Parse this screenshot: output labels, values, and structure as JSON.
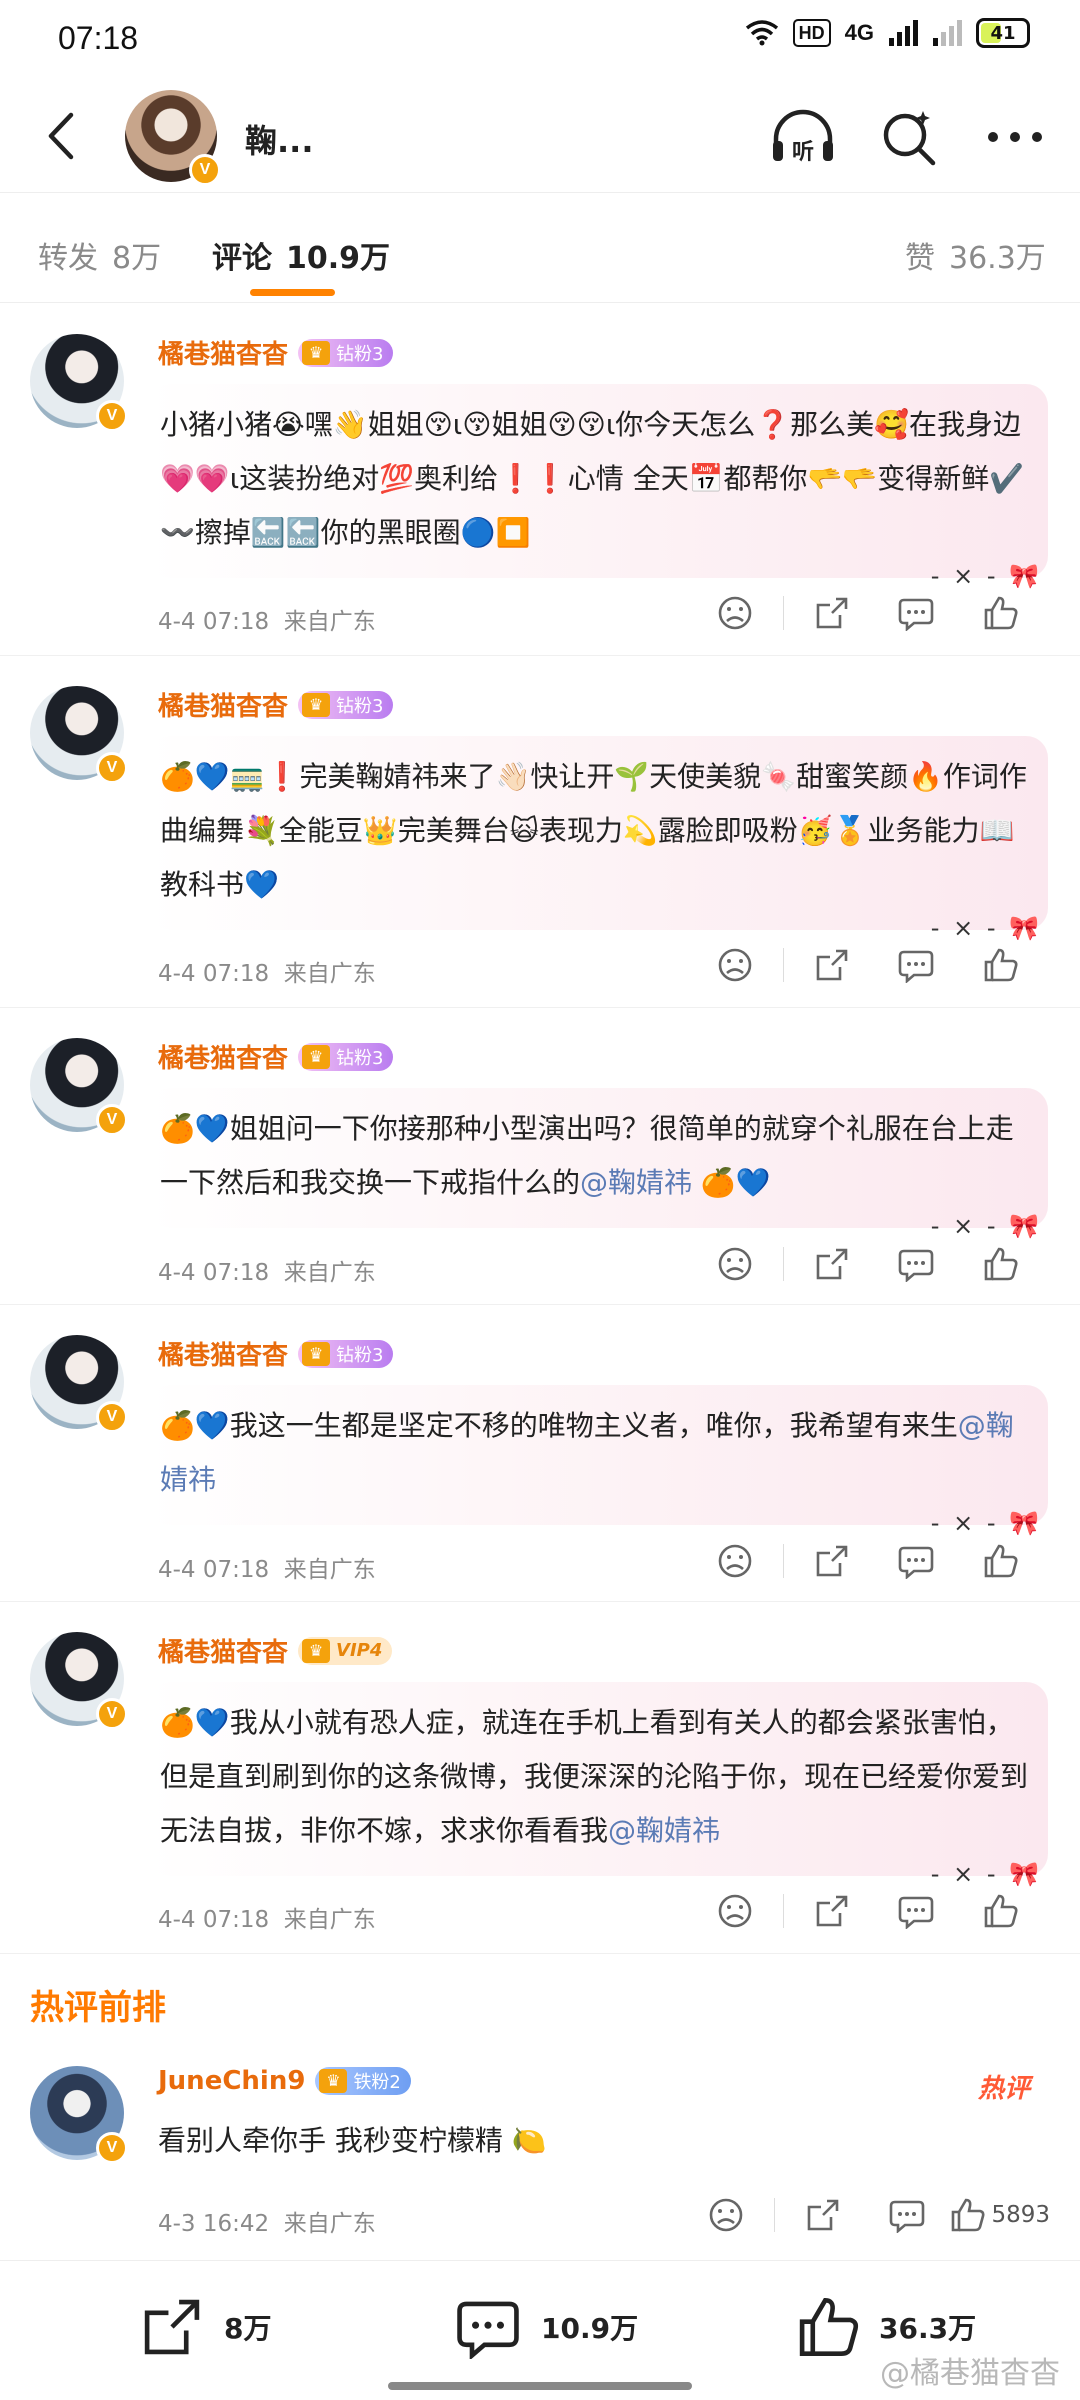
{
  "status_bar": {
    "time": "07:18",
    "network": "4G",
    "hd": "HD",
    "battery": "41"
  },
  "header": {
    "title": "鞠..."
  },
  "tabs": [
    {
      "label": "转发",
      "count": "8万"
    },
    {
      "label": "评论",
      "count": "10.9万"
    },
    {
      "label": "赞",
      "count": "36.3万"
    }
  ],
  "comments": [
    {
      "user": "橘巷猫杳杳",
      "badge": "钻粉3",
      "text_parts": [
        "小猪小猪😭嘿👋姐姐😚ι😚姐姐😚😚ι你今天怎么❓那么美🥰在我身边💗💗ι这装扮绝对💯奥利给❗❗心情 全天📅都帮你🫳🫳变得新鲜✔️〰️擦掉🔙🔙你的黑眼圈🔵⏹️"
      ],
      "mention": "",
      "text_after": "",
      "date": "4-4 07:18",
      "location": "来自广东"
    },
    {
      "user": "橘巷猫杳杳",
      "badge": "钻粉3",
      "text_parts": [
        "🍊💙🚃❗完美鞠婧祎来了👋🏻快让开🌱天使美貌🍬甜蜜笑颜🔥作词作曲编舞💐全能豆👑完美舞台🙀表现力💫露脸即吸粉🥳🏅业务能力📖教科书💙"
      ],
      "mention": "",
      "text_after": "",
      "date": "4-4 07:18",
      "location": "来自广东"
    },
    {
      "user": "橘巷猫杳杳",
      "badge": "钻粉3",
      "text_parts": [
        "🍊💙姐姐问一下你接那种小型演出吗？很简单的就穿个礼服在台上走一下然后和我交换一下戒指什么的"
      ],
      "mention": "@鞠婧祎",
      "text_after": " 🍊💙",
      "date": "4-4 07:18",
      "location": "来自广东"
    },
    {
      "user": "橘巷猫杳杳",
      "badge": "钻粉3",
      "text_parts": [
        "🍊💙我这一生都是坚定不移的唯物主义者，唯你，我希望有来生"
      ],
      "mention": "@鞠婧祎",
      "text_after": "",
      "date": "4-4 07:18",
      "location": "来自广东"
    },
    {
      "user": "橘巷猫杳杳",
      "badge": "VIP4",
      "text_parts": [
        "🍊💙我从小就有恐人症，就连在手机上看到有关人的都会紧张害怕，但是直到刷到你的这条微博，我便深深的沦陷于你，现在已经爱你爱到无法自拔，非你不嫁，求求你看看我"
      ],
      "mention": "@鞠婧祎",
      "text_after": "",
      "date": "4-4 07:18",
      "location": "来自广东"
    }
  ],
  "hot_section": {
    "title": "热评前排",
    "tag": "热评",
    "comment": {
      "user": "JuneChin9",
      "badge": "铁粉2",
      "text": "看别人牵你手 我秒变柠檬精 🍋",
      "date": "4-3 16:42",
      "location": "来自广东",
      "likes": "5893"
    }
  },
  "bottom_bar": {
    "repost": "8万",
    "comment": "10.9万",
    "like": "36.3万"
  },
  "watermark": "@橘巷猫杳杳",
  "colors": {
    "accent": "#ff8200",
    "username": "#e86b0c",
    "mention": "#5b7bb5"
  },
  "icons": [
    "back-icon",
    "headphone-listen-icon",
    "search-icon",
    "more-icon",
    "dislike-icon",
    "repost-icon",
    "comment-icon",
    "like-icon"
  ]
}
